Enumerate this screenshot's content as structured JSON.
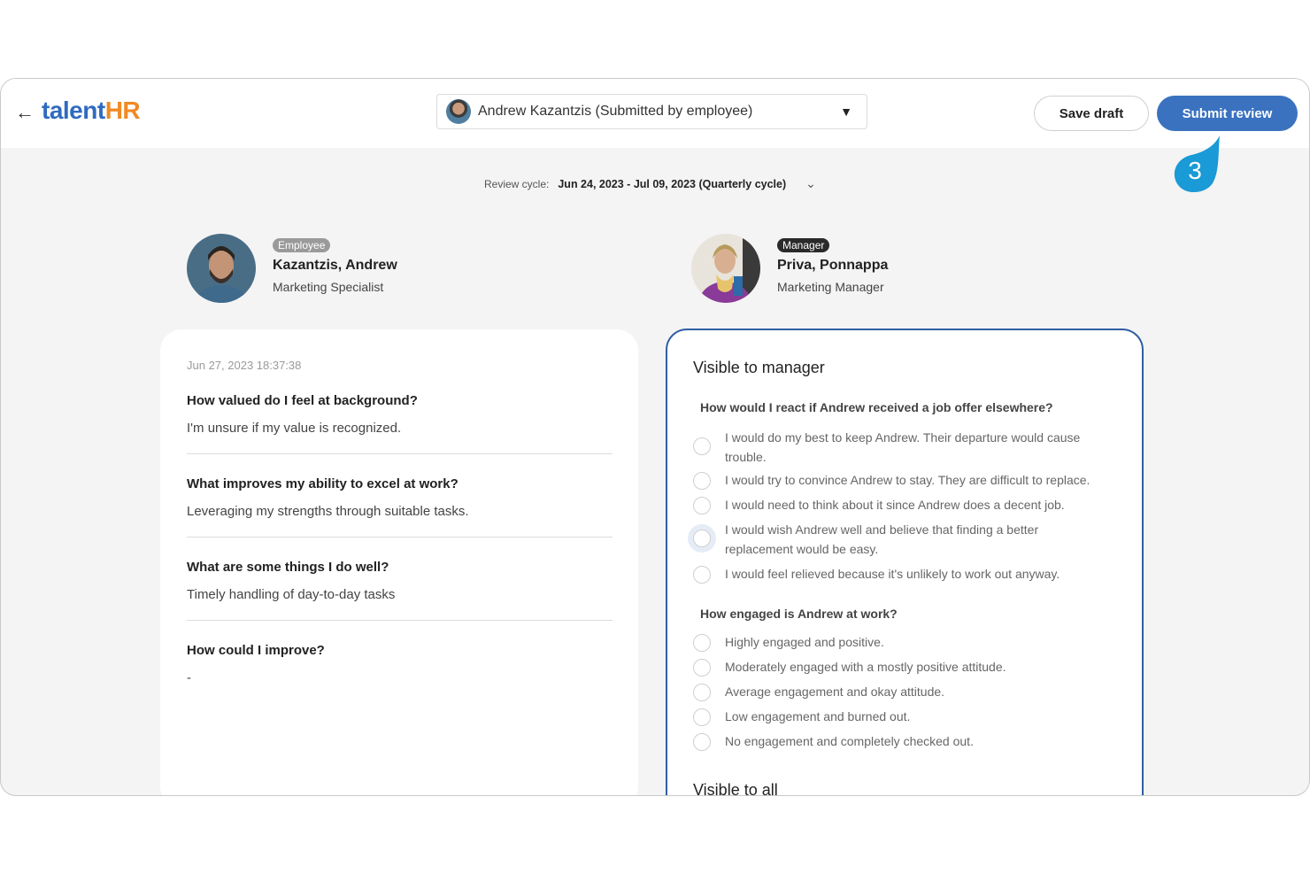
{
  "header": {
    "logo_talent": "talent",
    "logo_hr": "HR",
    "employee_select": "Andrew Kazantzis (Submitted by employee)",
    "save_draft": "Save draft",
    "submit_review": "Submit review",
    "step_marker": "3"
  },
  "review_cycle": {
    "label": "Review cycle:",
    "value": "Jun 24, 2023 - Jul 09, 2023 (Quarterly cycle)"
  },
  "employee": {
    "badge": "Employee",
    "name": "Kazantzis, Andrew",
    "role": "Marketing Specialist"
  },
  "manager": {
    "badge": "Manager",
    "name": "Priva, Ponnappa",
    "role": "Marketing Manager"
  },
  "self_review": {
    "date": "Jun 27, 2023 18:37:38",
    "items": [
      {
        "question": "How valued do I feel at background?",
        "answer": "I'm unsure if my value is recognized."
      },
      {
        "question": "What improves my ability to excel at work?",
        "answer": "Leveraging my strengths through suitable tasks."
      },
      {
        "question": "What are some things I do well?",
        "answer": "Timely handling of day-to-day tasks"
      },
      {
        "question": "How could I improve?",
        "answer": "-"
      }
    ]
  },
  "manager_form": {
    "section_title": "Visible to manager",
    "q1": {
      "title": "How would I react if Andrew received a job offer elsewhere?",
      "options": [
        "I would do my best to keep Andrew. Their departure would cause trouble.",
        "I would try to convince Andrew to stay. They are difficult to replace.",
        "I would need to think about it since Andrew does a decent job.",
        "I would wish Andrew well and believe that finding a better replacement would be easy.",
        "I would feel relieved because it's unlikely to work out anyway."
      ]
    },
    "q2": {
      "title": "How engaged is Andrew at work?",
      "options": [
        "Highly engaged and positive.",
        "Moderately engaged with a mostly positive attitude.",
        "Average engagement and okay attitude.",
        "Low engagement and burned out.",
        "No engagement and completely checked out."
      ]
    },
    "section2_title": "Visible to all"
  },
  "colors": {
    "primary": "#3a72bf",
    "accent_marker": "#1a9ad6",
    "logo_blue": "#2f6bbf",
    "logo_orange": "#f08a24",
    "employee_badge": "#9a9a9a",
    "manager_badge": "#2a2a2a"
  }
}
